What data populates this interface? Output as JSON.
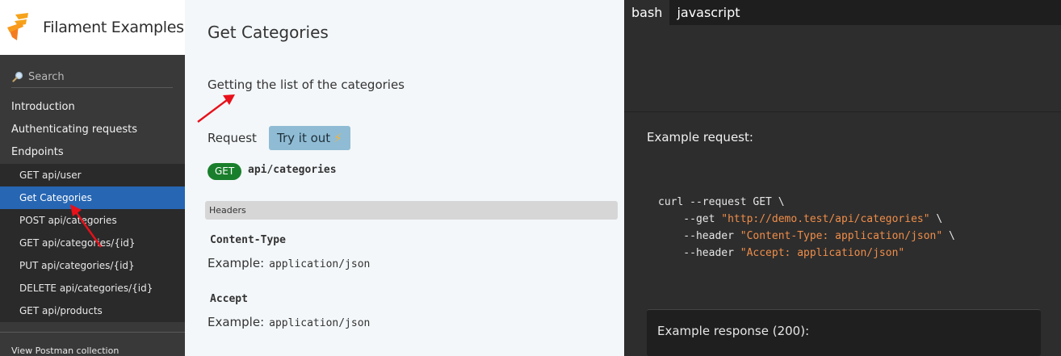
{
  "sidebar": {
    "brand": "Filament Examples",
    "search_placeholder": "Search",
    "sections": [
      {
        "label": "Introduction"
      },
      {
        "label": "Authenticating requests"
      },
      {
        "label": "Endpoints"
      }
    ],
    "endpoints": [
      {
        "label": "GET api/user",
        "active": false
      },
      {
        "label": "Get Categories",
        "active": true
      },
      {
        "label": "POST api/categories",
        "active": false
      },
      {
        "label": "GET api/categories/{id}",
        "active": false
      },
      {
        "label": "PUT api/categories/{id}",
        "active": false
      },
      {
        "label": "DELETE api/categories/{id}",
        "active": false
      },
      {
        "label": "GET api/products",
        "active": false
      }
    ],
    "postman_link": "View Postman collection"
  },
  "main": {
    "title": "Get Categories",
    "description": "Getting the list of the categories",
    "request_label": "Request",
    "try_button_label": "Try it out",
    "try_button_icon": "⚡",
    "method": "GET",
    "endpoint": "api/categories",
    "headers_section_label": "Headers",
    "example_label": "Example:",
    "headers": [
      {
        "name": "Content-Type",
        "example": "application/json"
      },
      {
        "name": "Accept",
        "example": "application/json"
      }
    ]
  },
  "code_panel": {
    "tabs": [
      {
        "label": "bash",
        "active": true
      },
      {
        "label": "javascript",
        "active": false
      }
    ],
    "example_request_label": "Example request:",
    "code": {
      "line1": "curl --request GET \\",
      "line2_flag": "    --get ",
      "line2_str": "\"http://demo.test/api/categories\"",
      "line2_tail": " \\",
      "line3_flag": "    --header ",
      "line3_str": "\"Content-Type: application/json\"",
      "line3_tail": " \\",
      "line4_flag": "    --header ",
      "line4_str": "\"Accept: application/json\""
    },
    "example_response_label": "Example response (200):"
  },
  "colors": {
    "sidebar_bg": "#393939",
    "active_item": "#2666b3",
    "get_badge": "#1a7f2c",
    "try_button": "#8fbcd4",
    "code_string": "#f08d49",
    "annotation_arrow": "#e8101a"
  }
}
